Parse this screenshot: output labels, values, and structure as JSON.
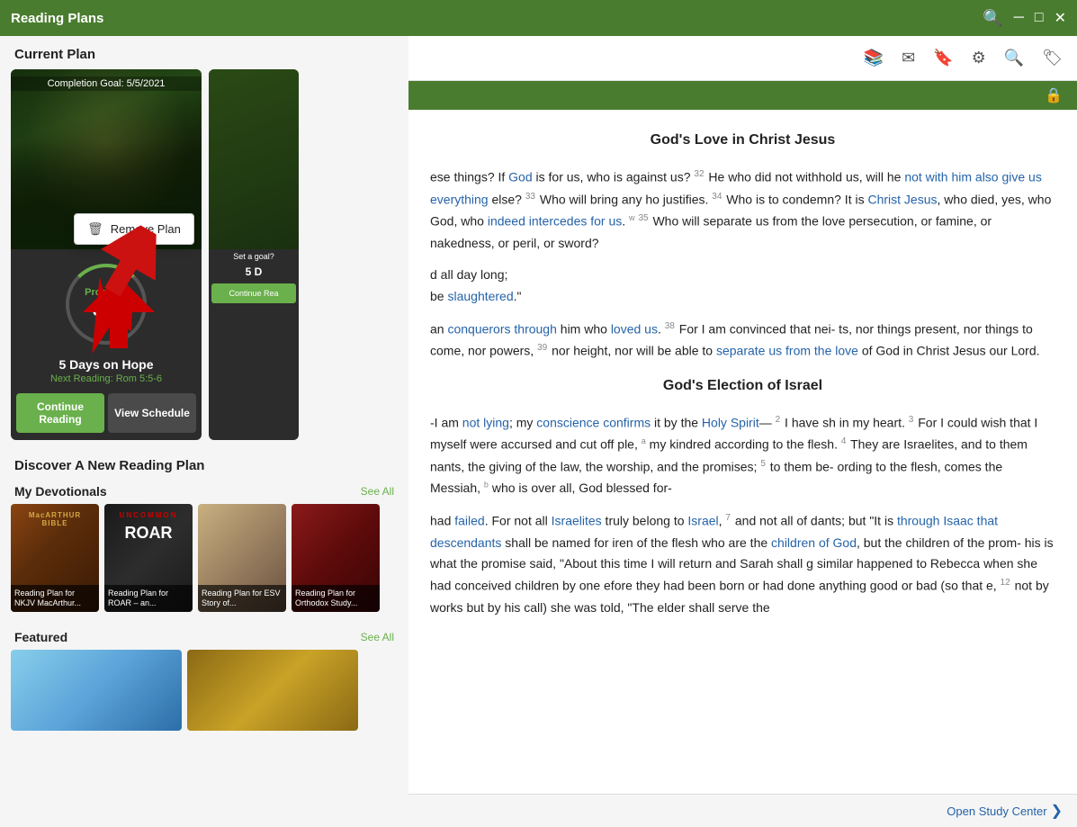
{
  "window": {
    "title": "Reading Plans",
    "controls": {
      "minimize": "─",
      "maximize": "□",
      "close": "✕"
    }
  },
  "left_panel": {
    "current_plan_heading": "Current Plan",
    "card1": {
      "completion_goal": "Completion Goal: 5/5/2021",
      "progress_label": "Progress",
      "progress_value": "0%",
      "plan_title": "5 Days on Hope",
      "next_reading_label": "Next Reading: Rom 5:5-6",
      "btn_continue": "Continue Reading",
      "btn_schedule": "View Schedule"
    },
    "card2": {
      "set_goal": "Set a goal?",
      "plan_title": "5 D",
      "btn_continue": "Continue Rea"
    },
    "context_menu": {
      "label": "Remove Plan"
    },
    "discover_heading": "Discover A New Reading Plan",
    "devotionals": {
      "heading": "My Devotionals",
      "see_all": "See All",
      "cards": [
        {
          "label": "Reading Plan for NKJV MacArthur..."
        },
        {
          "label": "Reading Plan for ROAR – an..."
        },
        {
          "label": "Reading Plan for ESV Story of..."
        },
        {
          "label": "Reading Plan for Orthodox Study..."
        }
      ]
    },
    "featured": {
      "heading": "Featured",
      "see_all": "See All",
      "cards": [
        {
          "label": ""
        },
        {
          "label": ""
        }
      ]
    }
  },
  "right_panel": {
    "toolbar": {
      "icons": [
        "library",
        "envelope",
        "bookmark-list",
        "settings",
        "search",
        "bookmark"
      ]
    },
    "bible": {
      "section1_title": "God's Love in Christ Jesus",
      "section2_title": "God's Election of Israel",
      "verses": [
        "ese things? If God is for us, who is against us?",
        "He who did not withhold us, will he not with him also give us everything else?",
        "Who will bring any ho justifies.",
        "Who is to condemn? It is Christ Jesus, who died, yes, who God, who indeed intercedes for us.",
        "Who will separate us from the love persecution, or famine, or nakedness, or peril, or sword?",
        "d all day long; be slaughtered.",
        "an conquerors through him who loved us.",
        "For I am convinced that neither things present, nor things to come, nor powers,",
        "nor height, nor will be able to separate us from the love of God in Christ Jesus our Lord.",
        "I am not lying; my conscience confirms it by the Holy Spirit—",
        "I have sh in my heart.",
        "For I could wish that I myself were accursed and cut off ple, my kindred according to the flesh.",
        "They are Israelites, and to them nants, the giving of the law, the worship, and the promises;",
        "to them be- ording to the flesh, comes the Messiah, who is over all, God blessed for-",
        "had failed. For not all Israelites truly belong to Israel,",
        "and not all of dants; but \"It is through Isaac that descendants shall be named for iren of the flesh who are the children of God, but the children of the prom-",
        "his is what the promise said, \"About this time I will return and Sarah shall g similar happened to Rebecca when she had conceived children by one efore they had been born or had done anything good or bad (so that e,",
        "not by works but by his call) she was told, \"The elder shall serve the"
      ]
    },
    "study_center": {
      "link": "Open Study Center",
      "arrow": "❯"
    }
  }
}
